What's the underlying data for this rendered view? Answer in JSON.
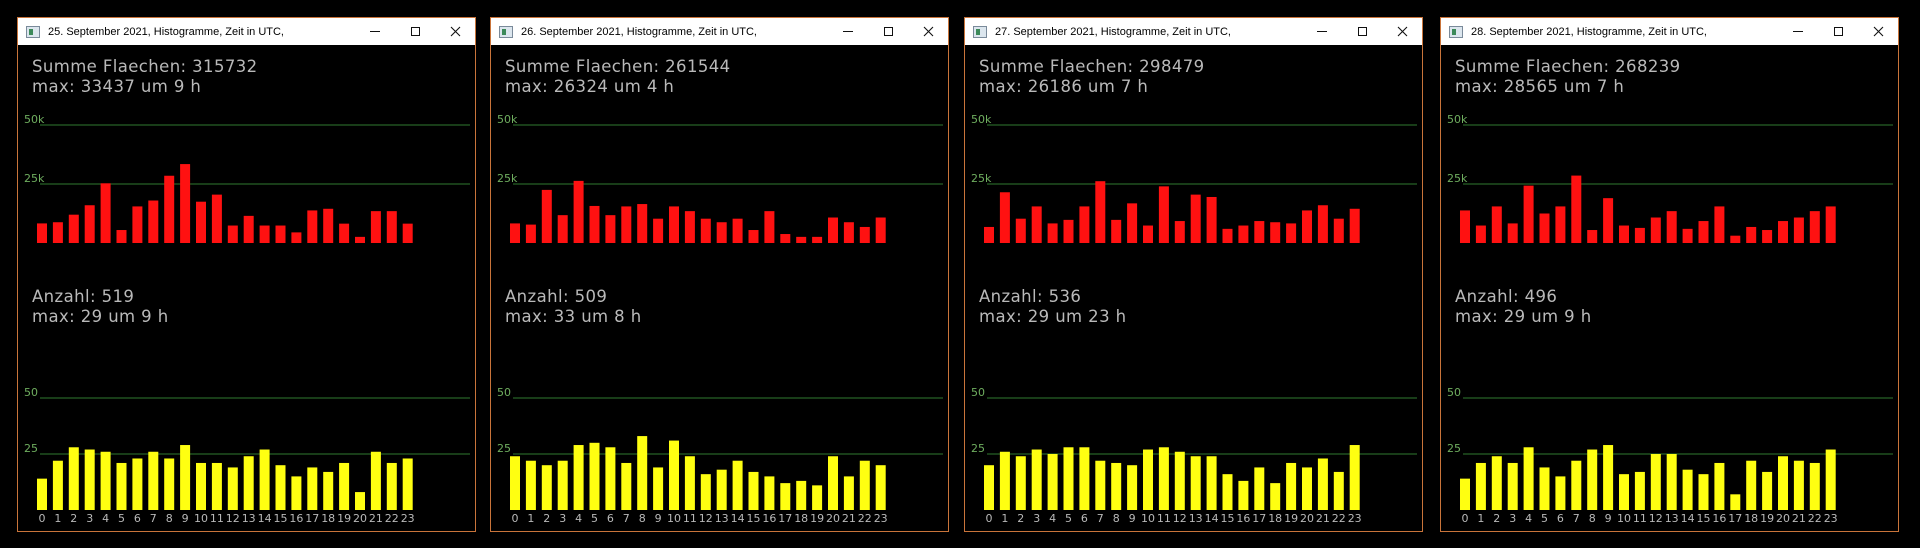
{
  "colors": {
    "red_bar": "#ff1111",
    "yellow_bar": "#ffff11",
    "grid": "#2f7a2f",
    "grid_label": "#6fae5f",
    "text": "#b9b9b9",
    "border": "#c9743a"
  },
  "x_tick_labels": [
    "0",
    "1",
    "2",
    "3",
    "4",
    "5",
    "6",
    "7",
    "8",
    "9",
    "10",
    "11",
    "12",
    "13",
    "14",
    "15",
    "16",
    "17",
    "18",
    "19",
    "20",
    "21",
    "22",
    "23"
  ],
  "windows": [
    {
      "title": "25. September 2021, Histogramme, Zeit in UTC,",
      "area_label": "Summe Flaechen: 315732",
      "area_max_label": "max: 33437 um 9 h",
      "count_label": "Anzahl: 519",
      "count_max_label": "max: 29 um 9 h",
      "area_grid_labels": [
        "50k",
        "25k"
      ],
      "count_grid_labels": [
        "50",
        "25"
      ],
      "chart_data": [
        {
          "type": "bar",
          "title": "",
          "categories": [
            "0",
            "1",
            "2",
            "3",
            "4",
            "5",
            "6",
            "7",
            "8",
            "9",
            "10",
            "11",
            "12",
            "13",
            "14",
            "15",
            "16",
            "17",
            "18",
            "19",
            "20",
            "21",
            "22",
            "23"
          ],
          "values": [
            8300,
            8800,
            12000,
            16000,
            25300,
            5500,
            15500,
            18000,
            28500,
            33437,
            17500,
            20500,
            7400,
            11500,
            7400,
            7400,
            4500,
            13800,
            14500,
            8200,
            2600,
            13500,
            13500,
            8200
          ],
          "ylim": [
            0,
            60000
          ]
        },
        {
          "type": "bar",
          "title": "",
          "categories": [
            "0",
            "1",
            "2",
            "3",
            "4",
            "5",
            "6",
            "7",
            "8",
            "9",
            "10",
            "11",
            "12",
            "13",
            "14",
            "15",
            "16",
            "17",
            "18",
            "19",
            "20",
            "21",
            "22",
            "23"
          ],
          "values": [
            14,
            22,
            28,
            27,
            26,
            21,
            23,
            26,
            23,
            29,
            21,
            21,
            19,
            24,
            27,
            20,
            15,
            19,
            17,
            21,
            8,
            26,
            21,
            23
          ],
          "ylim": [
            0,
            60
          ]
        }
      ]
    },
    {
      "title": "26. September 2021, Histogramme, Zeit in UTC,",
      "area_label": "Summe Flaechen: 261544",
      "area_max_label": "max: 26324 um 4 h",
      "count_label": "Anzahl: 509",
      "count_max_label": "max: 33 um 8 h",
      "area_grid_labels": [
        "50k",
        "25k"
      ],
      "count_grid_labels": [
        "50",
        "25"
      ],
      "chart_data": [
        {
          "type": "bar",
          "title": "",
          "categories": [
            "0",
            "1",
            "2",
            "3",
            "4",
            "5",
            "6",
            "7",
            "8",
            "9",
            "10",
            "11",
            "12",
            "13",
            "14",
            "15",
            "16",
            "17",
            "18",
            "19",
            "20",
            "21",
            "22",
            "23"
          ],
          "values": [
            8300,
            7800,
            22500,
            11800,
            26324,
            15700,
            11800,
            15500,
            16500,
            10300,
            15500,
            13500,
            10300,
            8800,
            10300,
            5500,
            13500,
            3800,
            2600,
            2600,
            10800,
            8800,
            6800,
            10800
          ],
          "ylim": [
            0,
            60000
          ]
        },
        {
          "type": "bar",
          "title": "",
          "categories": [
            "0",
            "1",
            "2",
            "3",
            "4",
            "5",
            "6",
            "7",
            "8",
            "9",
            "10",
            "11",
            "12",
            "13",
            "14",
            "15",
            "16",
            "17",
            "18",
            "19",
            "20",
            "21",
            "22",
            "23"
          ],
          "values": [
            24,
            22,
            20,
            22,
            29,
            30,
            28,
            21,
            33,
            19,
            31,
            24,
            16,
            18,
            22,
            17,
            15,
            12,
            13,
            11,
            24,
            15,
            22,
            20
          ],
          "ylim": [
            0,
            60
          ]
        }
      ]
    },
    {
      "title": "27. September 2021, Histogramme, Zeit in UTC,",
      "area_label": "Summe Flaechen: 298479",
      "area_max_label": "max: 26186 um 7 h",
      "count_label": "Anzahl: 536",
      "count_max_label": "max: 29 um 23 h",
      "area_grid_labels": [
        "50k",
        "25k"
      ],
      "count_grid_labels": [
        "50",
        "25"
      ],
      "chart_data": [
        {
          "type": "bar",
          "title": "",
          "categories": [
            "0",
            "1",
            "2",
            "3",
            "4",
            "5",
            "6",
            "7",
            "8",
            "9",
            "10",
            "11",
            "12",
            "13",
            "14",
            "15",
            "16",
            "17",
            "18",
            "19",
            "20",
            "21",
            "22",
            "23"
          ],
          "values": [
            6800,
            21500,
            10300,
            15500,
            8300,
            9800,
            15500,
            26186,
            9800,
            16800,
            7400,
            24000,
            9300,
            20500,
            19500,
            6000,
            7400,
            9300,
            8800,
            8300,
            13800,
            16000,
            10300,
            14500
          ],
          "ylim": [
            0,
            60000
          ]
        },
        {
          "type": "bar",
          "title": "",
          "categories": [
            "0",
            "1",
            "2",
            "3",
            "4",
            "5",
            "6",
            "7",
            "8",
            "9",
            "10",
            "11",
            "12",
            "13",
            "14",
            "15",
            "16",
            "17",
            "18",
            "19",
            "20",
            "21",
            "22",
            "23"
          ],
          "values": [
            20,
            26,
            24,
            27,
            25,
            28,
            28,
            22,
            21,
            20,
            27,
            28,
            26,
            24,
            24,
            16,
            13,
            19,
            12,
            21,
            19,
            23,
            17,
            29
          ],
          "ylim": [
            0,
            60
          ]
        }
      ]
    },
    {
      "title": "28. September 2021, Histogramme, Zeit in UTC,",
      "area_label": "Summe Flaechen: 268239",
      "area_max_label": "max: 28565 um 7 h",
      "count_label": "Anzahl: 496",
      "count_max_label": "max: 29 um 9 h",
      "area_grid_labels": [
        "50k",
        "25k"
      ],
      "count_grid_labels": [
        "50",
        "25"
      ],
      "chart_data": [
        {
          "type": "bar",
          "title": "",
          "categories": [
            "0",
            "1",
            "2",
            "3",
            "4",
            "5",
            "6",
            "7",
            "8",
            "9",
            "10",
            "11",
            "12",
            "13",
            "14",
            "15",
            "16",
            "17",
            "18",
            "19",
            "20",
            "21",
            "22",
            "23"
          ],
          "values": [
            13800,
            7400,
            15500,
            8300,
            24300,
            12500,
            15500,
            28565,
            5500,
            19000,
            7400,
            6400,
            10800,
            13500,
            6000,
            9300,
            15500,
            3100,
            6800,
            5500,
            9300,
            10800,
            13500,
            15500
          ],
          "ylim": [
            0,
            60000
          ]
        },
        {
          "type": "bar",
          "title": "",
          "categories": [
            "0",
            "1",
            "2",
            "3",
            "4",
            "5",
            "6",
            "7",
            "8",
            "9",
            "10",
            "11",
            "12",
            "13",
            "14",
            "15",
            "16",
            "17",
            "18",
            "19",
            "20",
            "21",
            "22",
            "23"
          ],
          "values": [
            14,
            21,
            24,
            21,
            28,
            19,
            15,
            22,
            27,
            29,
            16,
            17,
            25,
            25,
            18,
            16,
            21,
            7,
            22,
            17,
            24,
            22,
            21,
            27
          ],
          "ylim": [
            0,
            60
          ]
        }
      ]
    }
  ]
}
